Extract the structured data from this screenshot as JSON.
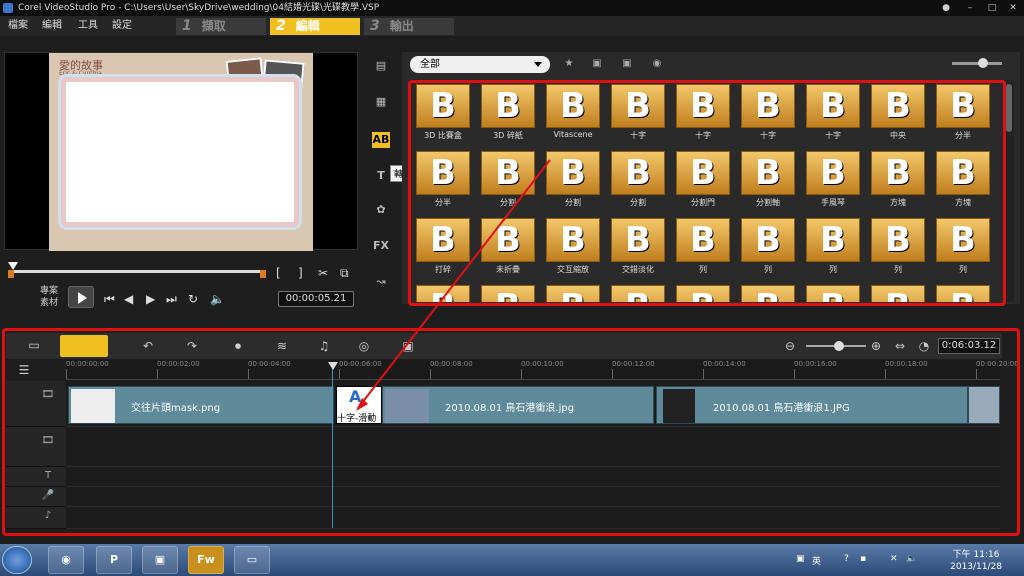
{
  "window": {
    "title": "Corel VideoStudio Pro - C:\\Users\\User\\SkyDrive\\wedding\\04結婚光碟\\光碟教學.VSP"
  },
  "menu": [
    "檔案",
    "編輯",
    "工具",
    "設定"
  ],
  "steps": [
    {
      "num": "1",
      "label": "擷取"
    },
    {
      "num": "2",
      "label": "編輯"
    },
    {
      "num": "3",
      "label": "輸出"
    }
  ],
  "preview": {
    "frame_title": "愛的故事",
    "frame_sub": "Eric & Cynthia",
    "mode_project": "專案",
    "mode_clip": "素材",
    "timecode": "00:00:05.21"
  },
  "tooltip": "轉場",
  "library": {
    "category": "全部",
    "tile_glyph": "B",
    "rows": [
      [
        "3D 比賽盒",
        "3D 碎紙",
        "Vitascene",
        "十字",
        "十字",
        "十字",
        "十字",
        "中央",
        "分半"
      ],
      [
        "分半",
        "分割",
        "分割",
        "分割",
        "分割門",
        "分割軸",
        "手風琴",
        "方塊",
        "方塊"
      ],
      [
        "打碎",
        "未折疊",
        "交互縮放",
        "交錯淡化",
        "列",
        "列",
        "列",
        "列",
        "列"
      ],
      [
        "",
        "",
        "",
        "",
        "",
        "",
        "",
        "",
        ""
      ]
    ]
  },
  "timeline": {
    "timecode": "0:06:03.12",
    "ruler": [
      "00:00:00:00",
      "00:00:02:00",
      "00:00:04:00",
      "00:00:06:00",
      "00:00:08:00",
      "00:00:10:00",
      "00:00:12:00",
      "00:00:14:00",
      "00:00:16:00",
      "00:00:18:00",
      "00:00:20:00"
    ],
    "clips": [
      {
        "label": "交往片頭mask.png"
      },
      {
        "label": "2010.08.01 鳥石港衝浪.jpg"
      },
      {
        "label": "2010.08.01 鳥石港衝浪1.JPG"
      }
    ],
    "transition_label": "十字-滑動",
    "transition_glyph": "A"
  },
  "taskbar": {
    "lang": "英",
    "time": "下午 11:16",
    "date": "2013/11/28",
    "fw": "Fw"
  },
  "colors": {
    "highlight": "#e01010",
    "accent": "#f0c020"
  }
}
